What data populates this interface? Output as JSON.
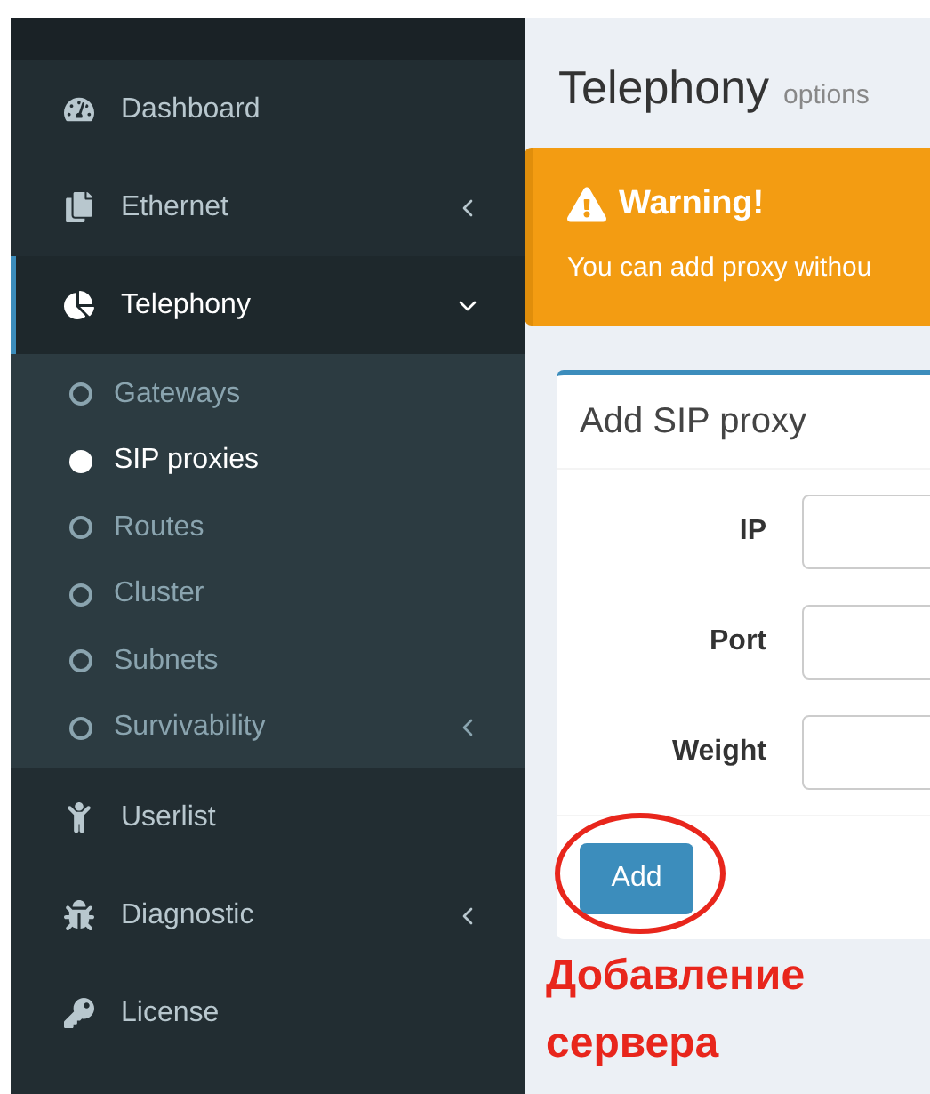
{
  "sidebar": {
    "items": [
      {
        "label": "Dashboard",
        "kind": "dashboard",
        "has_submenu": false,
        "expanded": false,
        "selected": false
      },
      {
        "label": "Ethernet",
        "kind": "ethernet",
        "has_submenu": true,
        "expanded": false,
        "selected": false
      },
      {
        "label": "Telephony",
        "kind": "telephony",
        "has_submenu": true,
        "expanded": true,
        "selected": true,
        "children": [
          {
            "label": "Gateways",
            "selected": false,
            "has_submenu": false
          },
          {
            "label": "SIP proxies",
            "selected": true,
            "has_submenu": false
          },
          {
            "label": "Routes",
            "selected": false,
            "has_submenu": false
          },
          {
            "label": "Cluster",
            "selected": false,
            "has_submenu": false
          },
          {
            "label": "Subnets",
            "selected": false,
            "has_submenu": false
          },
          {
            "label": "Survivability",
            "selected": false,
            "has_submenu": true
          }
        ]
      },
      {
        "label": "Userlist",
        "kind": "userlist",
        "has_submenu": false,
        "expanded": false,
        "selected": false
      },
      {
        "label": "Diagnostic",
        "kind": "diagnostic",
        "has_submenu": true,
        "expanded": false,
        "selected": false
      },
      {
        "label": "License",
        "kind": "license",
        "has_submenu": false,
        "expanded": false,
        "selected": false
      }
    ]
  },
  "page": {
    "title": "Telephony",
    "subtitle": "options"
  },
  "warning": {
    "title": "Warning!",
    "text": "You can add proxy withou"
  },
  "card": {
    "title": "Add SIP proxy",
    "fields": [
      {
        "label": "IP"
      },
      {
        "label": "Port"
      },
      {
        "label": "Weight"
      }
    ],
    "button": "Add"
  },
  "annotation": {
    "lines": [
      "Добавление",
      "сервера"
    ]
  }
}
